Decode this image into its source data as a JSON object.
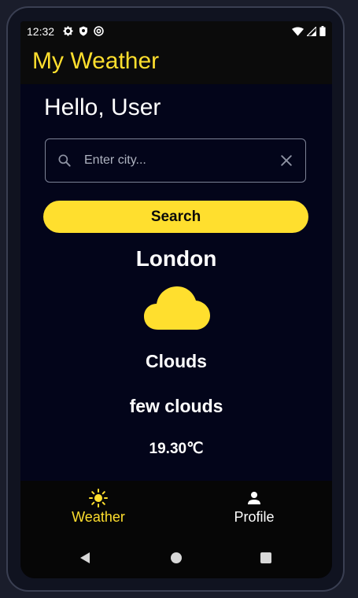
{
  "status_bar": {
    "time": "12:32",
    "left_icons": [
      "gear-icon",
      "shield-icon",
      "at-icon"
    ],
    "right_icons": [
      "wifi-icon",
      "signal-icon",
      "battery-icon"
    ]
  },
  "app_bar": {
    "title": "My Weather"
  },
  "greeting": "Hello, User",
  "search": {
    "placeholder": "Enter city...",
    "value": "",
    "button_label": "Search"
  },
  "weather": {
    "city": "London",
    "icon": "cloud-icon",
    "condition": "Clouds",
    "description": "few clouds",
    "temperature": "19.30℃"
  },
  "bottom_nav": {
    "items": [
      {
        "label": "Weather",
        "icon": "sun-icon",
        "active": true
      },
      {
        "label": "Profile",
        "icon": "person-icon",
        "active": false
      }
    ]
  },
  "colors": {
    "accent": "#ffdf2e",
    "background": "#03051a",
    "bar": "#0b0b0b",
    "text": "#ffffff"
  }
}
